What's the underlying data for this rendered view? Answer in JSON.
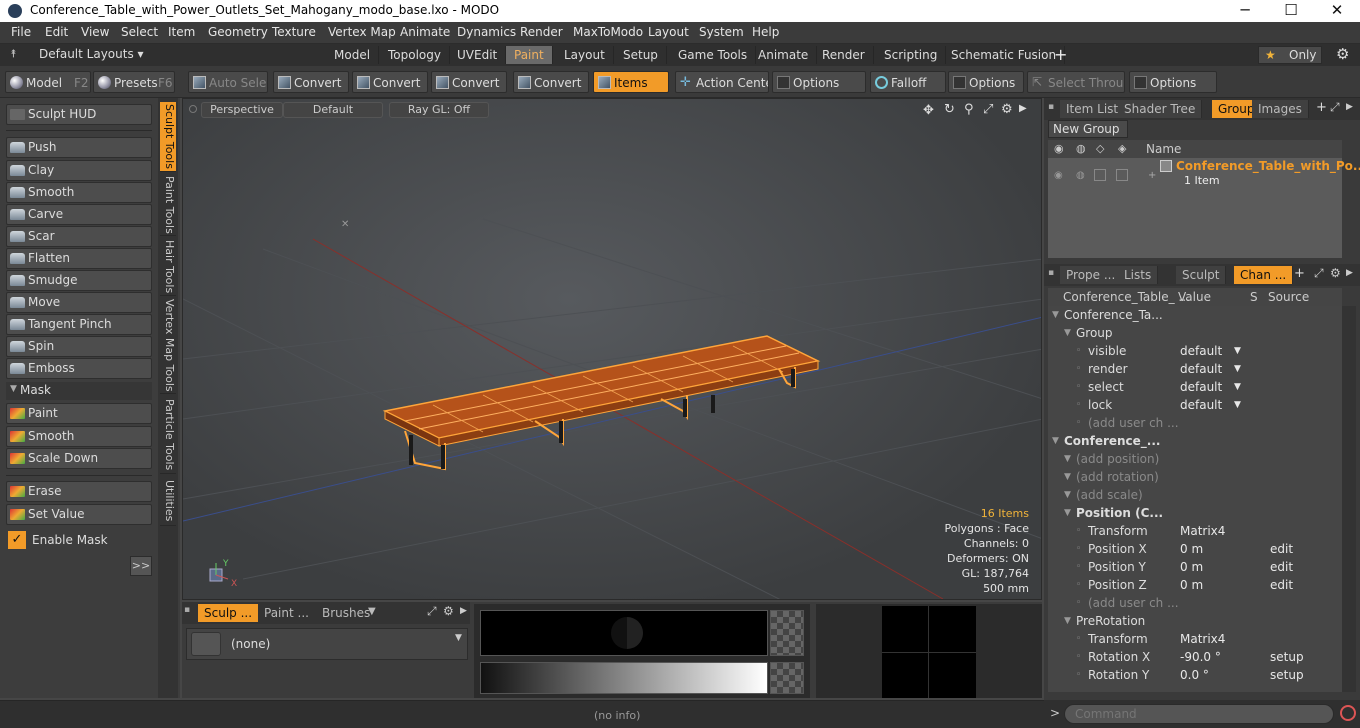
{
  "window": {
    "title": "Conference_Table_with_Power_Outlets_Set_Mahogany_modo_base.lxo - MODO",
    "minimize": "─",
    "maximize": "☐",
    "close": "✕"
  },
  "menu": [
    "File",
    "Edit",
    "View",
    "Select",
    "Item",
    "Geometry",
    "Texture",
    "Vertex Map",
    "Animate",
    "Dynamics",
    "Render",
    "MaxToModo",
    "Layout",
    "System",
    "Help"
  ],
  "layout_tabs": {
    "layouts_label": "Default Layouts ▾",
    "tabs": [
      "Model",
      "Topology",
      "UVEdit",
      "Paint",
      "Layout",
      "Setup",
      "Game Tools",
      "Animate",
      "Render",
      "Scripting",
      "Schematic Fusion"
    ],
    "add": "+",
    "only_label": "Only"
  },
  "toolbar": {
    "model": "Model",
    "model_key": "F2",
    "presets": "Presets",
    "presets_key": "F6",
    "auto_select": "Auto Select",
    "convert1": "Convert",
    "convert2": "Convert",
    "convert3": "Convert",
    "convert4": "Convert",
    "items": "Items",
    "action_center": "Action Center",
    "options1": "Options",
    "falloff": "Falloff",
    "options2": "Options",
    "select_through": "Select Through",
    "options3": "Options"
  },
  "left": {
    "sculpt_hud": "Sculpt HUD",
    "tools": [
      "Push",
      "Clay",
      "Smooth",
      "Carve",
      "Scar",
      "Flatten",
      "Smudge",
      "Move",
      "Tangent Pinch",
      "Spin",
      "Emboss"
    ],
    "mask_header": "Mask",
    "mask_tools": [
      "Paint",
      "Smooth",
      "Scale Down"
    ],
    "erase": "Erase",
    "set_value": "Set Value",
    "enable_mask": "Enable Mask",
    "more": ">>",
    "vtabs": [
      "Sculpt Tools",
      "Paint Tools",
      "Hair Tools",
      "Vertex Map Tools",
      "Particle Tools",
      "Utilities"
    ]
  },
  "viewport": {
    "perspective": "Perspective",
    "default": "Default",
    "raygl": "Ray GL: Off",
    "stats": {
      "items": "16 Items",
      "polygons": "Polygons : Face",
      "channels": "Channels: 0",
      "deformers": "Deformers: ON",
      "gl": "GL: 187,764",
      "size": "500 mm"
    },
    "axis_y": "Y",
    "axis_x": "X"
  },
  "bottom": {
    "tabs": [
      "Sculp ...",
      "Paint ...",
      "Brushes"
    ],
    "none": "(none)"
  },
  "status": {
    "info": "(no info)",
    "command_placeholder": "Command"
  },
  "right": {
    "top_tabs": [
      "Item List",
      "Shader Tree",
      "Groups",
      "Images"
    ],
    "new_group": "New Group",
    "groups_col_name": "Name",
    "group_name": "Conference_Table_with_Po...",
    "group_count": "1 Item",
    "bottom_tabs": [
      "Prope ...",
      "Lists",
      "Sculpt",
      "Chan ..."
    ],
    "cols": {
      "name": "Conference_Table_ ...",
      "value": "Value",
      "s": "S",
      "source": "Source"
    },
    "channels": [
      {
        "name": "Conference_Ta...",
        "val": "",
        "src": "",
        "indent": 1,
        "cls": ""
      },
      {
        "name": "Group",
        "val": "",
        "src": "",
        "indent": 2,
        "cls": ""
      },
      {
        "name": "visible",
        "val": "default",
        "src": "▼",
        "indent": 3,
        "cls": ""
      },
      {
        "name": "render",
        "val": "default",
        "src": "▼",
        "indent": 3,
        "cls": ""
      },
      {
        "name": "select",
        "val": "default",
        "src": "▼",
        "indent": 3,
        "cls": ""
      },
      {
        "name": "lock",
        "val": "default",
        "src": "▼",
        "indent": 3,
        "cls": ""
      },
      {
        "name": "(add user ch ...",
        "val": "",
        "src": "",
        "indent": 3,
        "cls": "dim2"
      },
      {
        "name": "Conference_...",
        "val": "",
        "src": "",
        "indent": 1,
        "cls": "bold"
      },
      {
        "name": "(add position)",
        "val": "",
        "src": "",
        "indent": 2,
        "cls": "dim2"
      },
      {
        "name": "(add rotation)",
        "val": "",
        "src": "",
        "indent": 2,
        "cls": "dim2"
      },
      {
        "name": "(add scale)",
        "val": "",
        "src": "",
        "indent": 2,
        "cls": "dim2"
      },
      {
        "name": "Position (C...",
        "val": "",
        "src": "",
        "indent": 2,
        "cls": "bold"
      },
      {
        "name": "Transform",
        "val": "Matrix4",
        "src": "",
        "indent": 3,
        "cls": ""
      },
      {
        "name": "Position X",
        "val": "0 m",
        "src": "edit",
        "indent": 3,
        "cls": ""
      },
      {
        "name": "Position Y",
        "val": "0 m",
        "src": "edit",
        "indent": 3,
        "cls": ""
      },
      {
        "name": "Position Z",
        "val": "0 m",
        "src": "edit",
        "indent": 3,
        "cls": ""
      },
      {
        "name": "(add user ch ...",
        "val": "",
        "src": "",
        "indent": 3,
        "cls": "dim2"
      },
      {
        "name": "PreRotation",
        "val": "",
        "src": "",
        "indent": 2,
        "cls": ""
      },
      {
        "name": "Transform",
        "val": "Matrix4",
        "src": "",
        "indent": 3,
        "cls": ""
      },
      {
        "name": "Rotation X",
        "val": "-90.0 °",
        "src": "setup",
        "indent": 3,
        "cls": ""
      },
      {
        "name": "Rotation Y",
        "val": "0.0 °",
        "src": "setup",
        "indent": 3,
        "cls": ""
      }
    ]
  },
  "colors": {
    "accent": "#f29b28"
  }
}
